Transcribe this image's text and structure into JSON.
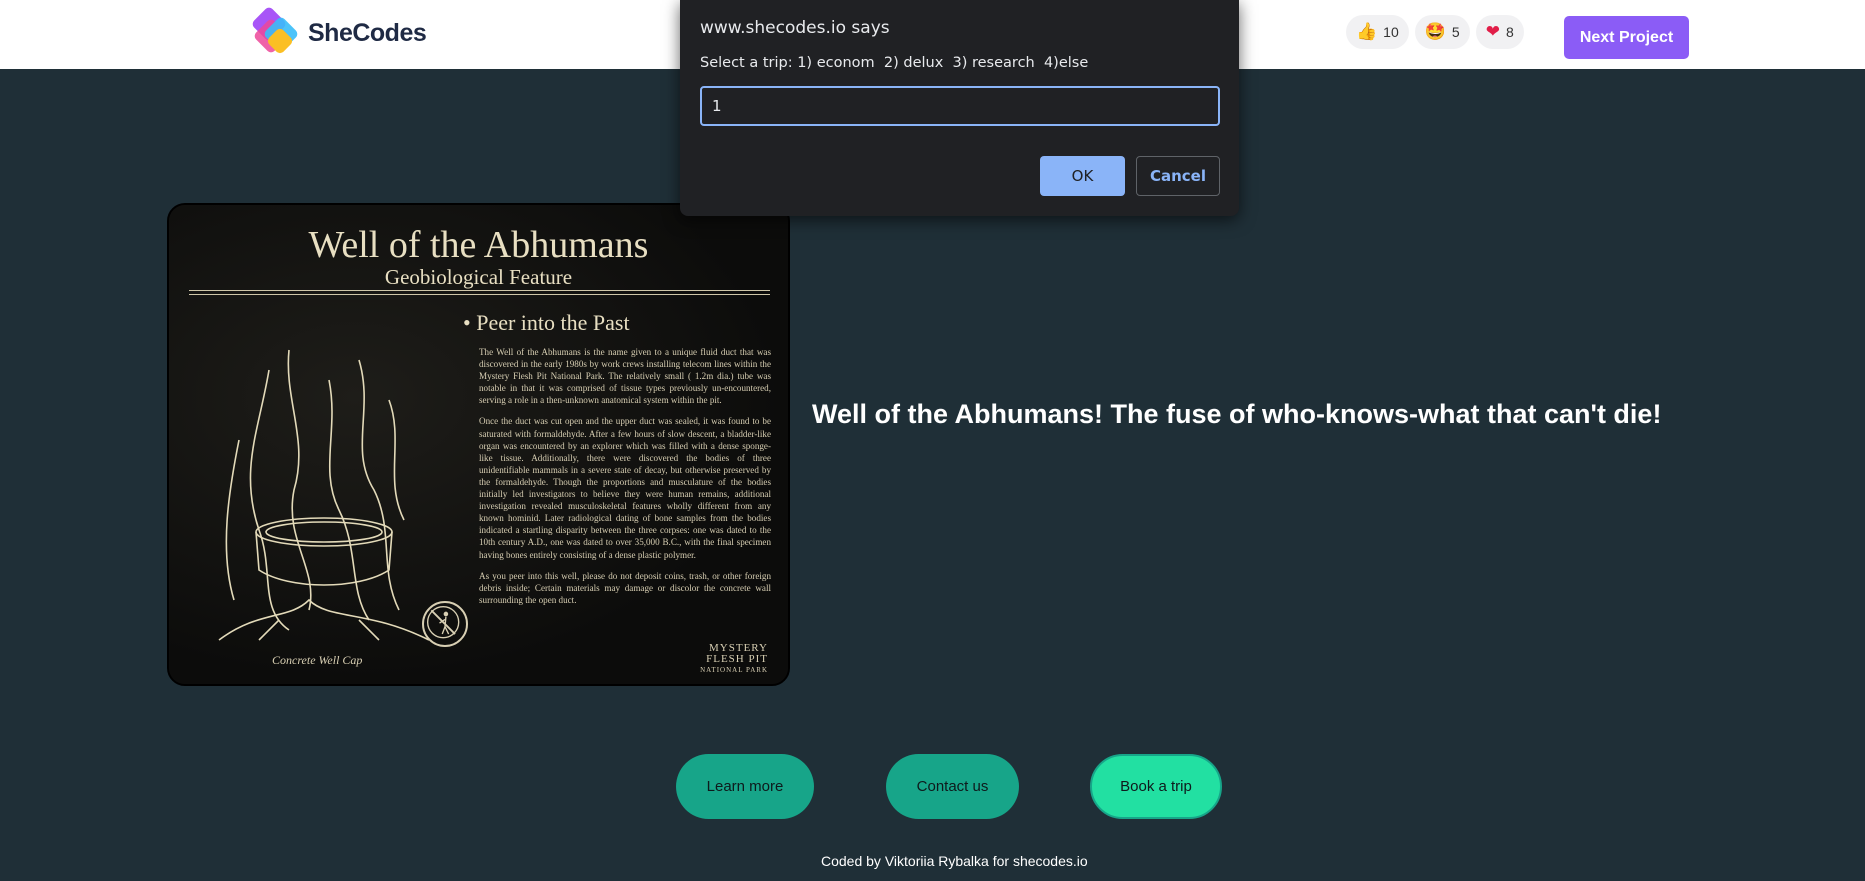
{
  "header": {
    "brand": "SheCodes",
    "reactions": [
      {
        "icon": "thumbs-up-icon",
        "glyph": "👍",
        "count": "10"
      },
      {
        "icon": "star-struck-icon",
        "glyph": "🤩",
        "count": "5"
      },
      {
        "icon": "heart-icon",
        "glyph": "❤",
        "count": "8"
      }
    ],
    "next_label": "Next Project",
    "accent": "#8b5cf6"
  },
  "hero": {
    "image": {
      "title": "Well of the Abhumans",
      "subtitle": "Geobiological Feature",
      "heading": "• Peer into the Past",
      "paragraphs": [
        "The Well of the Abhumans is the name given to a unique fluid duct that was discovered in the early 1980s by work crews installing telecom lines within the Mystery Flesh Pit National Park. The relatively small ( 1.2m dia.) tube was notable in that it was comprised of tissue types previously un-encountered, serving a role in a then-unknown anatomical system within the pit.",
        "Once the duct was cut open and the upper duct was sealed, it was found to be saturated with formaldehyde. After a few hours of slow descent, a bladder-like organ was encountered by an explorer which was filled with a dense sponge-like tissue. Additionally, there were discovered the bodies of three unidentifiable mammals in a severe state of decay, but otherwise preserved by the formaldehyde. Though the proportions and musculature of the bodies initially led investigators to believe they were human remains, additional investigation revealed musculoskeletal features wholly different from any known hominid. Later radiological dating of bone samples from the bodies indicated a startling disparity between the three corpses: one was dated to the 10th century A.D., one was dated to over 35,000 B.C., with the final specimen having bones entirely consisting of a dense plastic polymer.",
        "As you peer into this well, please do not deposit coins, trash, or other foreign debris inside; Certain materials may damage or discolor the concrete wall surrounding the open duct."
      ],
      "caption": "Concrete Well Cap",
      "brand_lines": [
        "MYSTERY",
        "FLESH PIT",
        "NATIONAL PARK"
      ]
    },
    "tagline": "Well of the Abhumans! The fuse of who-knows-what that can't die!"
  },
  "buttons": {
    "learn": "Learn more",
    "contact": "Contact us",
    "book": "Book a trip"
  },
  "footer": {
    "text": "Coded by Viktoriia Rybalka for shecodes.io"
  },
  "dialog": {
    "title": "www.shecodes.io says",
    "message": "Select a trip: 1) econom  2) delux  3) research  4)else",
    "input_value": "1",
    "ok": "OK",
    "cancel": "Cancel"
  }
}
